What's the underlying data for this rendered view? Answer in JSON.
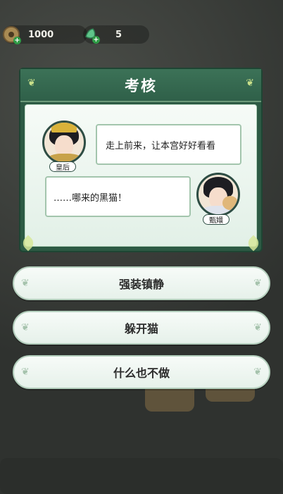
{
  "resources": {
    "coins": "1000",
    "gems": "5"
  },
  "dialog": {
    "title": "考核",
    "speaker_left": {
      "name": "皇后",
      "line": "走上前来，让本宫好好看看"
    },
    "speaker_right": {
      "name": "甄嬛",
      "line": "……哪来的黑猫！"
    }
  },
  "options": [
    {
      "label": "强装镇静"
    },
    {
      "label": "躲开猫"
    },
    {
      "label": "什么也不做"
    }
  ],
  "colors": {
    "panel_green": "#2d5a44",
    "title_text": "#ffffff",
    "option_bg": "#eef6f1"
  }
}
